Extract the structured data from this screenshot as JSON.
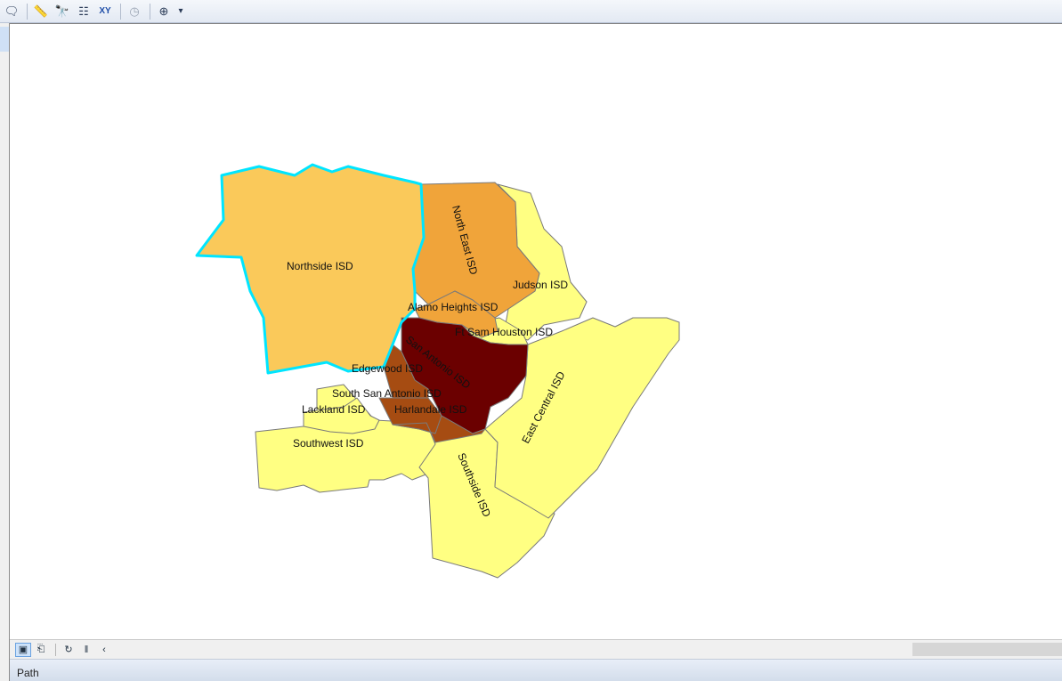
{
  "toolbar": {
    "icons": [
      "html-popup-icon",
      "measure-icon",
      "find-icon",
      "identify-icon",
      "goto-xy-icon",
      "time-slider-icon",
      "zoom-window-icon",
      "overflow-chevron-icon"
    ]
  },
  "map": {
    "districts": [
      {
        "name": "Northside ISD",
        "fill": "#fac95a",
        "label": "Northside ISD"
      },
      {
        "name": "North East ISD",
        "fill": "#f0a43a",
        "label": "North East ISD"
      },
      {
        "name": "Judson ISD",
        "fill": "#ffff82",
        "label": "Judson ISD"
      },
      {
        "name": "Alamo Heights ISD",
        "fill": "#f0a43a",
        "label": "Alamo Heights ISD"
      },
      {
        "name": "Ft Sam Houston ISD",
        "fill": "#ffff82",
        "label": "Ft Sam Houston ISD"
      },
      {
        "name": "San Antonio ISD",
        "fill": "#6b0000",
        "label": "San Antonio ISD"
      },
      {
        "name": "Edgewood ISD",
        "fill": "#a64c12",
        "label": "Edgewood ISD"
      },
      {
        "name": "South San Antonio ISD",
        "fill": "#a64c12",
        "label": "South San Antonio ISD"
      },
      {
        "name": "Harlandale ISD",
        "fill": "#a64c12",
        "label": "Harlandale ISD"
      },
      {
        "name": "Lackland ISD",
        "fill": "#ffff82",
        "label": "Lackland ISD"
      },
      {
        "name": "Southwest ISD",
        "fill": "#ffff82",
        "label": "Southwest ISD"
      },
      {
        "name": "Southside ISD",
        "fill": "#ffff82",
        "label": "Southside ISD"
      },
      {
        "name": "East Central ISD",
        "fill": "#ffff82",
        "label": "East Central ISD"
      }
    ],
    "selection_color": "#00e5ff",
    "border_color": "#7a7a7a"
  },
  "statusbar": {
    "buttons": [
      "data-view-icon",
      "layout-view-icon",
      "refresh-icon",
      "pause-icon",
      "scroll-left-icon"
    ]
  },
  "bottom": {
    "label": "Path"
  }
}
